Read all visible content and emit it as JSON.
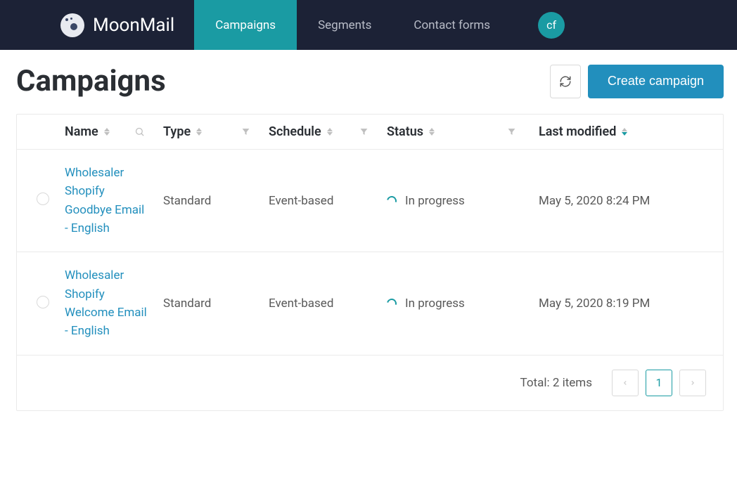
{
  "app_name": "MoonMail",
  "nav": {
    "items": [
      {
        "label": "Campaigns",
        "active": true
      },
      {
        "label": "Segments",
        "active": false
      },
      {
        "label": "Contact forms",
        "active": false
      }
    ]
  },
  "avatar_initials": "cf",
  "page_title": "Campaigns",
  "actions": {
    "refresh_title": "Refresh",
    "create_label": "Create campaign"
  },
  "table": {
    "columns": {
      "name": "Name",
      "type": "Type",
      "schedule": "Schedule",
      "status": "Status",
      "last_modified": "Last modified"
    },
    "rows": [
      {
        "name": "Wholesaler Shopify Goodbye Email - English",
        "type": "Standard",
        "schedule": "Event-based",
        "status": "In progress",
        "last_modified": "May 5, 2020 8:24 PM"
      },
      {
        "name": "Wholesaler Shopify Welcome Email - English",
        "type": "Standard",
        "schedule": "Event-based",
        "status": "In progress",
        "last_modified": "May 5, 2020 8:19 PM"
      }
    ]
  },
  "pagination": {
    "total_label": "Total: 2 items",
    "current_page": "1"
  }
}
